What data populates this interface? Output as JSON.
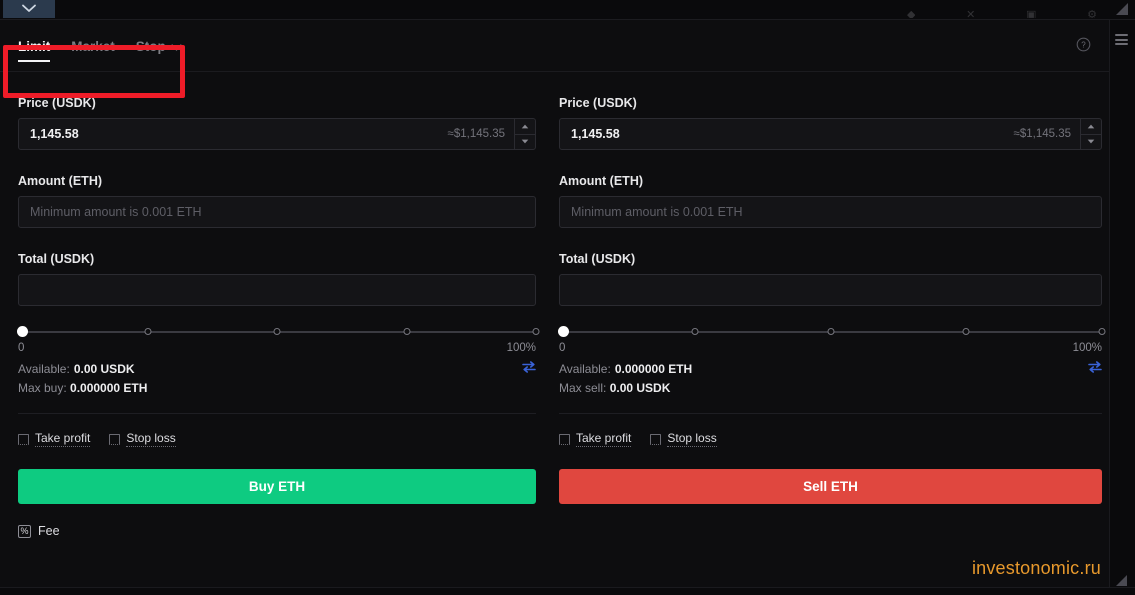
{
  "window": {
    "tab_chip_icon": "chevron-down-icon",
    "menu_icon": "hamburger-menu-icon",
    "resize_grip_icon": "resize-grip-icon"
  },
  "order_form": {
    "tabs": [
      {
        "label": "Limit",
        "active": true
      },
      {
        "label": "Market",
        "active": false
      },
      {
        "label": "Stop",
        "active": false,
        "has_dropdown": true
      }
    ],
    "help_icon": "help-circle-icon"
  },
  "buy": {
    "price_label": "Price (USDK)",
    "price_value": "1,145.58",
    "price_approx": "≈$1,145.35",
    "amount_label": "Amount (ETH)",
    "amount_value": "",
    "amount_placeholder": "Minimum amount is 0.001 ETH",
    "total_label": "Total (USDK)",
    "total_value": "",
    "total_placeholder": "",
    "slider_min_label": "0",
    "slider_max_label": "100%",
    "slider_value": 0,
    "slider_ticks": [
      0,
      25,
      50,
      75,
      100
    ],
    "available_label": "Available:",
    "available_value": "0.00 USDK",
    "max_label": "Max buy:",
    "max_value": "0.000000 ETH",
    "swap_icon": "swap-arrows-icon",
    "take_profit_label": "Take profit",
    "stop_loss_label": "Stop loss",
    "take_profit_checked": false,
    "stop_loss_checked": false,
    "action_label": "Buy ETH",
    "fee_label": "Fee",
    "fee_icon": "percent-box-icon"
  },
  "sell": {
    "price_label": "Price (USDK)",
    "price_value": "1,145.58",
    "price_approx": "≈$1,145.35",
    "amount_label": "Amount (ETH)",
    "amount_value": "",
    "amount_placeholder": "Minimum amount is 0.001 ETH",
    "total_label": "Total (USDK)",
    "total_value": "",
    "total_placeholder": "",
    "slider_min_label": "0",
    "slider_max_label": "100%",
    "slider_value": 0,
    "slider_ticks": [
      0,
      25,
      50,
      75,
      100
    ],
    "available_label": "Available:",
    "available_value": "0.000000 ETH",
    "max_label": "Max sell:",
    "max_value": "0.00 USDK",
    "swap_icon": "swap-arrows-icon",
    "take_profit_label": "Take profit",
    "stop_loss_label": "Stop loss",
    "take_profit_checked": false,
    "stop_loss_checked": false,
    "action_label": "Sell ETH"
  },
  "annotation": {
    "color": "#ee1c28",
    "target": "order-type-tabs"
  },
  "watermark": {
    "text": "investonomic.ru",
    "color": "#e8992c"
  },
  "colors": {
    "buy": "#0ecb81",
    "sell": "#e0473f",
    "accent_swap": "#3a63d8",
    "background": "#0d0d0f"
  }
}
